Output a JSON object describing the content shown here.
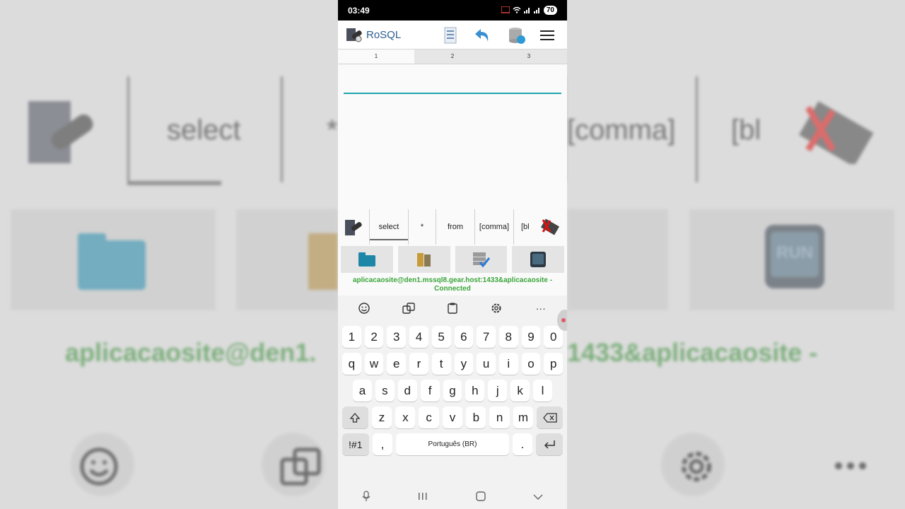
{
  "status": {
    "time": "03:49",
    "battery": "70"
  },
  "app": {
    "title": "RoSQL"
  },
  "tabs": [
    "1",
    "2",
    "3"
  ],
  "editor": {
    "value": "",
    "placeholder": ""
  },
  "keywords": [
    "select",
    "*",
    "from",
    "[comma]",
    "[bl"
  ],
  "connection": {
    "text": "aplicacaosite@den1.mssql8.gear.host:1433&aplicacaosite - Connected"
  },
  "keyboard": {
    "numbers": [
      "1",
      "2",
      "3",
      "4",
      "5",
      "6",
      "7",
      "8",
      "9",
      "0"
    ],
    "row1": [
      "q",
      "w",
      "e",
      "r",
      "t",
      "y",
      "u",
      "i",
      "o",
      "p"
    ],
    "row2": [
      "a",
      "s",
      "d",
      "f",
      "g",
      "h",
      "j",
      "k",
      "l"
    ],
    "row3": [
      "z",
      "x",
      "c",
      "v",
      "b",
      "n",
      "m"
    ],
    "symbols_label": "!#1",
    "comma_label": ",",
    "space_label": "Português (BR)",
    "period_label": ".",
    "more_label": "···"
  },
  "background": {
    "words": [
      "select",
      "*",
      "[comma]",
      "[bl"
    ],
    "connection_partial": "aplicacaosite@den1.",
    "connection_partial_right": "1433&aplicacaosite -",
    "run_label": "RUN"
  },
  "colors": {
    "accent": "#1ea6b0",
    "connected": "#3aa53a",
    "brand": "#2c5d8f"
  }
}
